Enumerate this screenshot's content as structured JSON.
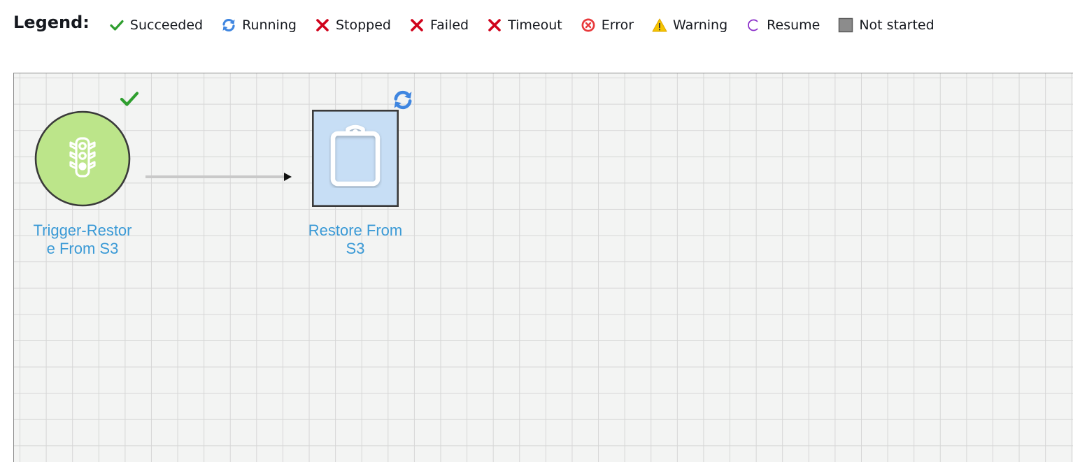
{
  "legend": {
    "title": "Legend:",
    "items": [
      {
        "key": "succeeded",
        "label": "Succeeded",
        "icon": "check-icon",
        "color": "#2e9e2e"
      },
      {
        "key": "running",
        "label": "Running",
        "icon": "refresh-icon",
        "color": "#3f86e0"
      },
      {
        "key": "stopped",
        "label": "Stopped",
        "icon": "x-icon",
        "color": "#d0021b"
      },
      {
        "key": "failed",
        "label": "Failed",
        "icon": "x-icon",
        "color": "#d0021b"
      },
      {
        "key": "timeout",
        "label": "Timeout",
        "icon": "x-icon",
        "color": "#d0021b"
      },
      {
        "key": "error",
        "label": "Error",
        "icon": "error-circle-icon",
        "color": "#e8393b"
      },
      {
        "key": "warning",
        "label": "Warning",
        "icon": "warning-triangle-icon",
        "color": "#f5c400"
      },
      {
        "key": "resume",
        "label": "Resume",
        "icon": "resume-arc-icon",
        "color": "#8b2fc9"
      },
      {
        "key": "not_started",
        "label": "Not started",
        "icon": "gray-square-icon",
        "color": "#8c8c8c"
      }
    ]
  },
  "workflow": {
    "nodes": [
      {
        "id": "trigger",
        "label_line1": "Trigger-Restor",
        "label_line2": "e From S3",
        "type": "trigger",
        "icon": "traffic-light-icon",
        "status": "succeeded",
        "fill_color": "#bce58a"
      },
      {
        "id": "job",
        "label_line1": "Restore From",
        "label_line2": "S3",
        "type": "job",
        "icon": "clipboard-icon",
        "status": "running",
        "fill_color": "#c7def5"
      }
    ]
  }
}
